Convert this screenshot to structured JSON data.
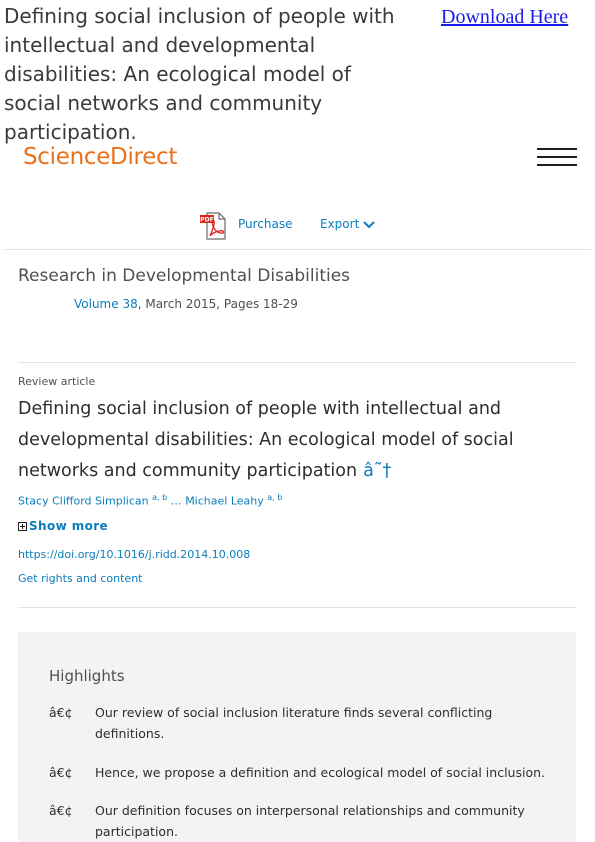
{
  "header": {
    "doc_title": "Defining social inclusion of people with intellectual and developmental disabilities: An ecological model of social networks and community participation.",
    "download_label": "Download Here"
  },
  "site": {
    "brand": "ScienceDirect"
  },
  "toolbar": {
    "purchase_label": "Purchase",
    "export_label": "Export"
  },
  "journal": {
    "name": "Research in Developmental Disabilities",
    "volume_link": "Volume 38",
    "volume_rest": ", March 2015, Pages 18-29"
  },
  "article": {
    "type": "Review article",
    "title": "Defining social inclusion of people with intellectual and developmental disabilities: An ecological model of social networks and community participation",
    "title_mark": "â˜†",
    "author1": "Stacy Clifford Simplican",
    "author1_sup": "a, b",
    "ellipsis": " … ",
    "author2": "Michael Leahy",
    "author2_sup": "a, b",
    "show_more": "Show more",
    "doi": "https://doi.org/10.1016/j.ridd.2014.10.008",
    "rights": "Get rights and content"
  },
  "highlights": {
    "title": "Highlights",
    "bullet": "â€¢",
    "items": [
      "Our review of social inclusion literature finds several conflicting definitions.",
      "Hence, we propose a definition and ecological model of social inclusion.",
      "Our definition focuses on interpersonal relationships and community participation."
    ]
  },
  "icons": {
    "pdf": "pdf-icon",
    "menu": "hamburger-menu-icon",
    "chevron": "chevron-down-icon",
    "expand": "plus-box-icon"
  },
  "colors": {
    "brand": "#e9711c",
    "link": "#0c7dbb",
    "download_link": "#1a1aee",
    "highlights_bg": "#f3f3f3"
  }
}
